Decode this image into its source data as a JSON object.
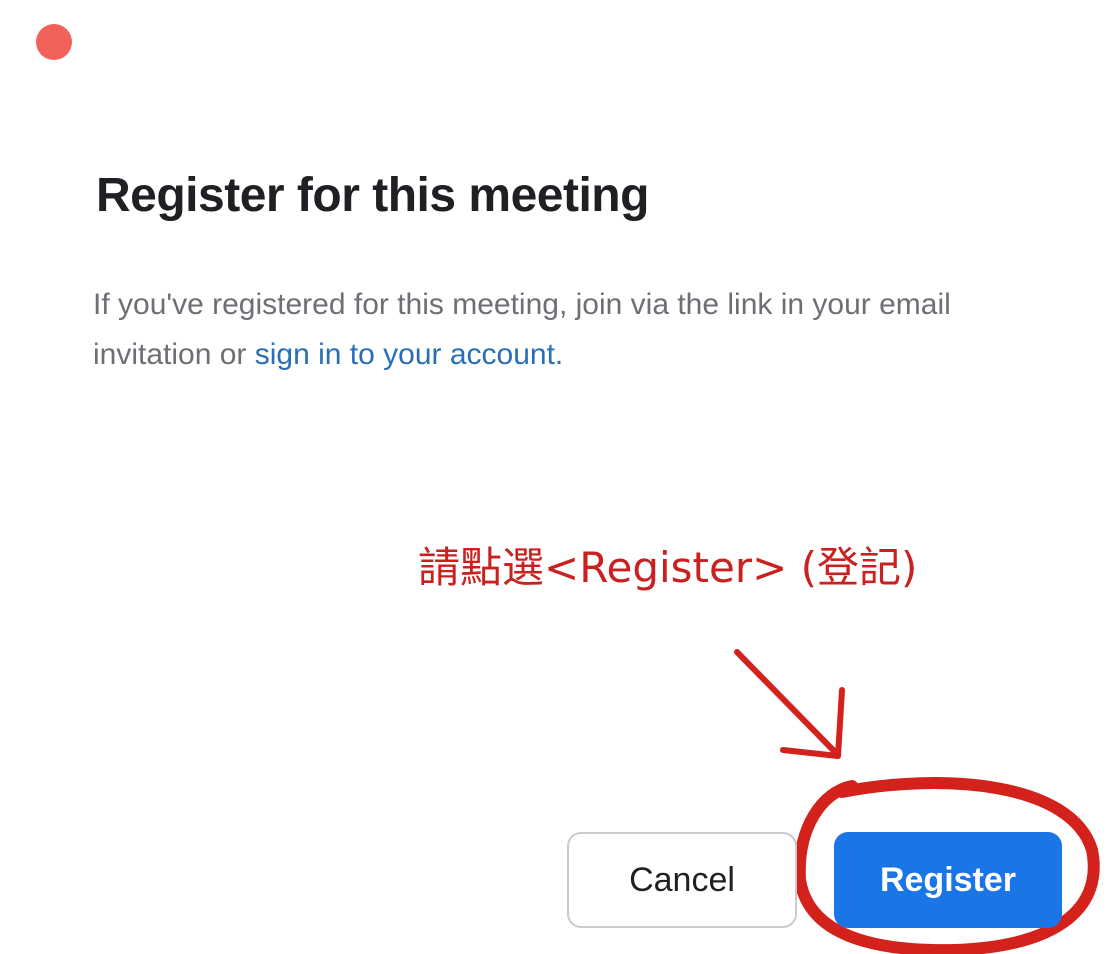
{
  "dialog": {
    "title": "Register for this meeting",
    "description_text": "If you've registered for this meeting, join via the link in your email invitation or ",
    "description_link": "sign in to your account."
  },
  "annotation": {
    "instruction": "請點選<Register> (登記)",
    "color": "#c8211f"
  },
  "buttons": {
    "cancel_label": "Cancel",
    "register_label": "Register"
  },
  "colors": {
    "close_dot": "#f2615a",
    "primary": "#1a75e6",
    "link": "#2a6fb5"
  }
}
